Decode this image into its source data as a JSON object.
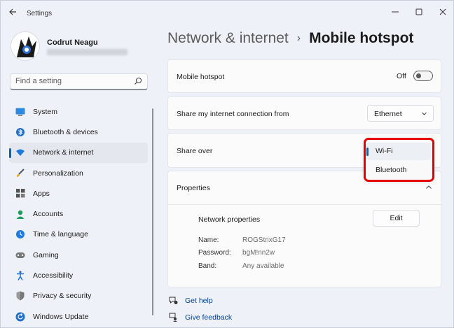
{
  "window": {
    "title": "Settings",
    "controls": {
      "minimize": "—",
      "maximize": "☐",
      "close": "✕"
    }
  },
  "user": {
    "name": "Codrut Neagu"
  },
  "search": {
    "placeholder": "Find a setting"
  },
  "sidebar": {
    "items": [
      {
        "label": "System",
        "icon": "monitor-icon",
        "active": false
      },
      {
        "label": "Bluetooth & devices",
        "icon": "bluetooth-icon",
        "active": false
      },
      {
        "label": "Network & internet",
        "icon": "wifi-icon",
        "active": true
      },
      {
        "label": "Personalization",
        "icon": "brush-icon",
        "active": false
      },
      {
        "label": "Apps",
        "icon": "apps-icon",
        "active": false
      },
      {
        "label": "Accounts",
        "icon": "person-icon",
        "active": false
      },
      {
        "label": "Time & language",
        "icon": "clock-globe-icon",
        "active": false
      },
      {
        "label": "Gaming",
        "icon": "gamepad-icon",
        "active": false
      },
      {
        "label": "Accessibility",
        "icon": "accessibility-icon",
        "active": false
      },
      {
        "label": "Privacy & security",
        "icon": "shield-icon",
        "active": false
      },
      {
        "label": "Windows Update",
        "icon": "update-icon",
        "active": false
      }
    ]
  },
  "header": {
    "parent": "Network & internet",
    "separator": "›",
    "current": "Mobile hotspot"
  },
  "hotspot": {
    "label": "Mobile hotspot",
    "state_label": "Off",
    "on": false
  },
  "share_from": {
    "label": "Share my internet connection from",
    "selected": "Ethernet"
  },
  "share_over": {
    "label": "Share over",
    "options": [
      {
        "label": "Wi-Fi",
        "selected": true
      },
      {
        "label": "Bluetooth",
        "selected": false
      }
    ]
  },
  "properties": {
    "title": "Properties",
    "network_properties_label": "Network properties",
    "edit_label": "Edit",
    "rows": [
      {
        "key": "Name:",
        "value": "ROGStrixG17"
      },
      {
        "key": "Password:",
        "value": "bgM!nn2w"
      },
      {
        "key": "Band:",
        "value": "Any available"
      }
    ]
  },
  "footer": {
    "get_help": "Get help",
    "give_feedback": "Give feedback"
  },
  "colors": {
    "accent": "#0067c0",
    "highlight": "#e60000",
    "link": "#003e92"
  }
}
